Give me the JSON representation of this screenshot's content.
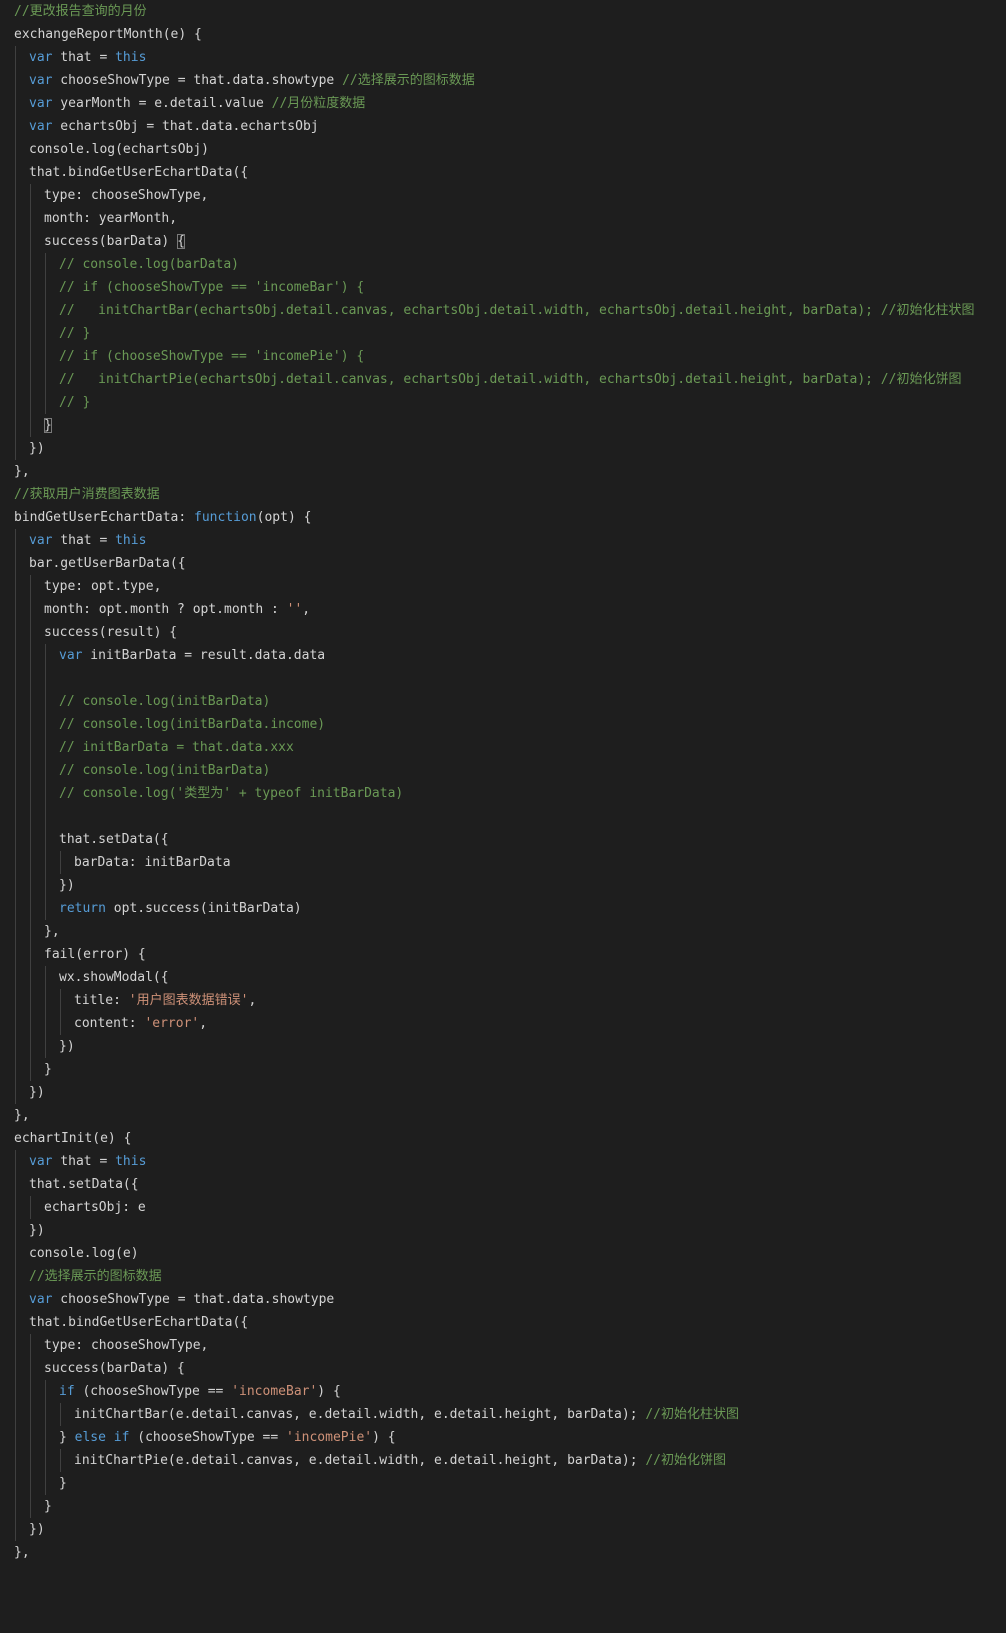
{
  "editor": {
    "lines": [
      [
        [
          "cm",
          "//更改报告查询的月份"
        ]
      ],
      [
        [
          "id",
          "exchangeReportMonth(e) {"
        ]
      ],
      [
        [
          "kw",
          "var"
        ],
        [
          "id",
          " that = "
        ],
        [
          "kw",
          "this"
        ]
      ],
      [
        [
          "kw",
          "var"
        ],
        [
          "id",
          " chooseShowType = that.data.showtype "
        ],
        [
          "cm",
          "//选择展示的图标数据"
        ]
      ],
      [
        [
          "kw",
          "var"
        ],
        [
          "id",
          " yearMonth = e.detail.value "
        ],
        [
          "cm",
          "//月份粒度数据"
        ]
      ],
      [
        [
          "kw",
          "var"
        ],
        [
          "id",
          " echartsObj = that.data.echartsObj"
        ]
      ],
      [
        [
          "id",
          "console.log(echartsObj)"
        ]
      ],
      [
        [
          "id",
          "that.bindGetUserEchartData({"
        ]
      ],
      [
        [
          "id",
          "type: chooseShowType,"
        ]
      ],
      [
        [
          "id",
          "month: yearMonth,"
        ]
      ],
      [
        [
          "id",
          "success(barData) "
        ],
        [
          "br",
          "{"
        ]
      ],
      [
        [
          "cm",
          "// console.log(barData)"
        ]
      ],
      [
        [
          "cm",
          "// if (chooseShowType == 'incomeBar') {"
        ]
      ],
      [
        [
          "cm",
          "//   initChartBar(echartsObj.detail.canvas, echartsObj.detail.width, echartsObj.detail.height, barData); //初始化柱状图"
        ]
      ],
      [
        [
          "cm",
          "// }"
        ]
      ],
      [
        [
          "cm",
          "// if (chooseShowType == 'incomePie') {"
        ]
      ],
      [
        [
          "cm",
          "//   initChartPie(echartsObj.detail.canvas, echartsObj.detail.width, echartsObj.detail.height, barData); //初始化饼图"
        ]
      ],
      [
        [
          "cm",
          "// }"
        ]
      ],
      [
        [
          "br",
          "}"
        ]
      ],
      [
        [
          "id",
          "})"
        ]
      ],
      [
        [
          "id",
          "},"
        ]
      ],
      [
        [
          "cm",
          "//获取用户消费图表数据"
        ]
      ],
      [
        [
          "id",
          "bindGetUserEchartData: "
        ],
        [
          "kw",
          "function"
        ],
        [
          "id",
          "(opt) {"
        ]
      ],
      [
        [
          "kw",
          "var"
        ],
        [
          "id",
          " that = "
        ],
        [
          "kw",
          "this"
        ]
      ],
      [
        [
          "id",
          "bar.getUserBarData({"
        ]
      ],
      [
        [
          "id",
          "type: opt.type,"
        ]
      ],
      [
        [
          "id",
          "month: opt.month ? opt.month : "
        ],
        [
          "st",
          "''"
        ],
        [
          "id",
          ","
        ]
      ],
      [
        [
          "id",
          "success(result) {"
        ]
      ],
      [
        [
          "kw",
          "var"
        ],
        [
          "id",
          " initBarData = result.data.data"
        ]
      ],
      [],
      [
        [
          "cm",
          "// console.log(initBarData)"
        ]
      ],
      [
        [
          "cm",
          "// console.log(initBarData.income)"
        ]
      ],
      [
        [
          "cm",
          "// initBarData = that.data.xxx"
        ]
      ],
      [
        [
          "cm",
          "// console.log(initBarData)"
        ]
      ],
      [
        [
          "cm",
          "// console.log('类型为' + typeof initBarData)"
        ]
      ],
      [],
      [
        [
          "id",
          "that.setData({"
        ]
      ],
      [
        [
          "id",
          "barData: initBarData"
        ]
      ],
      [
        [
          "id",
          "})"
        ]
      ],
      [
        [
          "kw",
          "return"
        ],
        [
          "id",
          " opt.success(initBarData)"
        ]
      ],
      [
        [
          "id",
          "},"
        ]
      ],
      [
        [
          "id",
          "fail(error) {"
        ]
      ],
      [
        [
          "id",
          "wx.showModal({"
        ]
      ],
      [
        [
          "id",
          "title: "
        ],
        [
          "st",
          "'用户图表数据错误'"
        ],
        [
          "id",
          ","
        ]
      ],
      [
        [
          "id",
          "content: "
        ],
        [
          "st",
          "'error'"
        ],
        [
          "id",
          ","
        ]
      ],
      [
        [
          "id",
          "})"
        ]
      ],
      [
        [
          "id",
          "}"
        ]
      ],
      [
        [
          "id",
          "})"
        ]
      ],
      [
        [
          "id",
          "},"
        ]
      ],
      [
        [
          "id",
          "echartInit(e) {"
        ]
      ],
      [
        [
          "kw",
          "var"
        ],
        [
          "id",
          " that = "
        ],
        [
          "kw",
          "this"
        ]
      ],
      [
        [
          "id",
          "that.setData({"
        ]
      ],
      [
        [
          "id",
          "echartsObj: e"
        ]
      ],
      [
        [
          "id",
          "})"
        ]
      ],
      [
        [
          "id",
          "console.log(e)"
        ]
      ],
      [
        [
          "cm",
          "//选择展示的图标数据"
        ]
      ],
      [
        [
          "kw",
          "var"
        ],
        [
          "id",
          " chooseShowType = that.data.showtype"
        ]
      ],
      [
        [
          "id",
          "that.bindGetUserEchartData({"
        ]
      ],
      [
        [
          "id",
          "type: chooseShowType,"
        ]
      ],
      [
        [
          "id",
          "success(barData) {"
        ]
      ],
      [
        [
          "kw",
          "if"
        ],
        [
          "id",
          " (chooseShowType == "
        ],
        [
          "st",
          "'incomeBar'"
        ],
        [
          "id",
          ") {"
        ]
      ],
      [
        [
          "id",
          "initChartBar(e.detail.canvas, e.detail.width, e.detail.height, barData); "
        ],
        [
          "cm",
          "//初始化柱状图"
        ]
      ],
      [
        [
          "id",
          "} "
        ],
        [
          "kw",
          "else"
        ],
        [
          "id",
          " "
        ],
        [
          "kw",
          "if"
        ],
        [
          "id",
          " (chooseShowType == "
        ],
        [
          "st",
          "'incomePie'"
        ],
        [
          "id",
          ") {"
        ]
      ],
      [
        [
          "id",
          "initChartPie(e.detail.canvas, e.detail.width, e.detail.height, barData); "
        ],
        [
          "cm",
          "//初始化饼图"
        ]
      ],
      [
        [
          "id",
          "}"
        ]
      ],
      [
        [
          "id",
          "}"
        ]
      ],
      [
        [
          "id",
          "})"
        ]
      ],
      [
        [
          "id",
          "},"
        ]
      ]
    ]
  }
}
